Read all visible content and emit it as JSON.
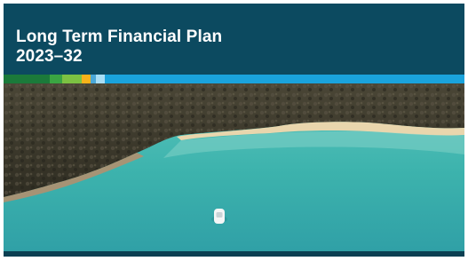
{
  "document": {
    "title_line1": "Long Term Financial Plan",
    "title_line2": "2023–32",
    "photo_subject": "aerial view of a turquoise bay with a small white boat, bushland shore and sandy beach"
  },
  "colors": {
    "header_bg": "#0c4a60",
    "title_text": "#ffffff",
    "stripe": [
      "#1b7a3a",
      "#3aa542",
      "#7cc242",
      "#f6b21a",
      "#4aa8d8",
      "#a9def5",
      "#1aa3dc"
    ],
    "water": "#3fb7b0",
    "sand": "#e9d6ad",
    "forest": "#3d3a2c"
  }
}
